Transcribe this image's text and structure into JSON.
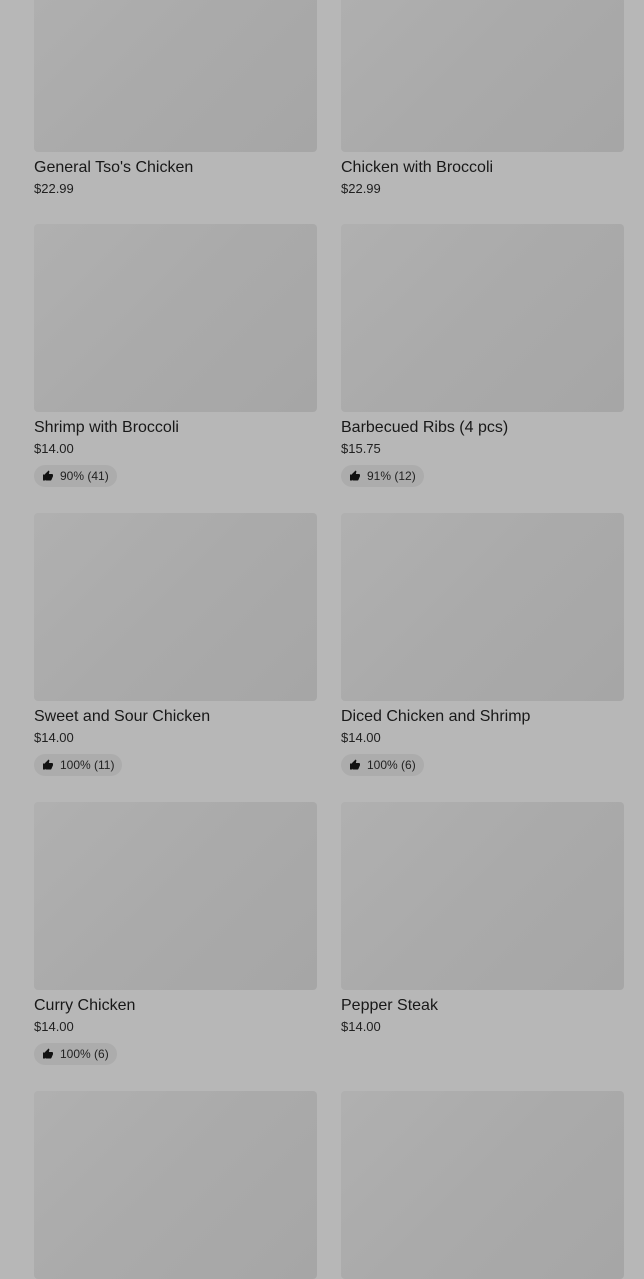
{
  "menu": {
    "items": [
      {
        "name": "General Tso's Chicken",
        "price": "$22.99",
        "rating": null
      },
      {
        "name": "Chicken with Broccoli",
        "price": "$22.99",
        "rating": null
      },
      {
        "name": "Shrimp with Broccoli",
        "price": "$14.00",
        "rating": "90% (41)"
      },
      {
        "name": "Barbecued Ribs (4 pcs)",
        "price": "$15.75",
        "rating": "91% (12)"
      },
      {
        "name": "Sweet and Sour Chicken",
        "price": "$14.00",
        "rating": "100% (11)"
      },
      {
        "name": "Diced Chicken and Shrimp",
        "price": "$14.00",
        "rating": "100% (6)"
      },
      {
        "name": "Curry Chicken",
        "price": "$14.00",
        "rating": "100% (6)"
      },
      {
        "name": "Pepper Steak",
        "price": "$14.00",
        "rating": null
      }
    ]
  },
  "icons": {
    "rating_icon": "thumbs-up-icon"
  }
}
